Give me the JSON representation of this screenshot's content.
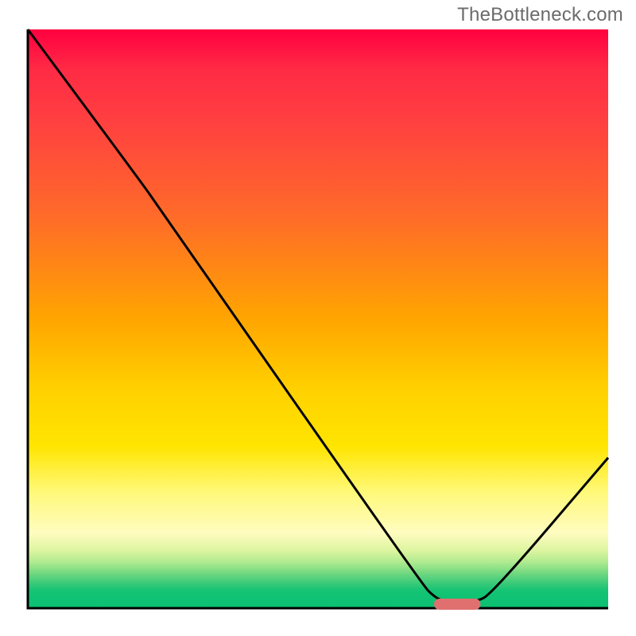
{
  "chart_data": {
    "type": "line",
    "watermark": "TheBottleneck.com",
    "xlabel": "",
    "ylabel": "",
    "xlim": [
      0,
      100
    ],
    "ylim": [
      0,
      100
    ],
    "curve_points": [
      {
        "x": 0,
        "y": 100
      },
      {
        "x": 20,
        "y": 73
      },
      {
        "x": 22,
        "y": 70
      },
      {
        "x": 68,
        "y": 4
      },
      {
        "x": 70,
        "y": 2
      },
      {
        "x": 72,
        "y": 1
      },
      {
        "x": 77,
        "y": 1
      },
      {
        "x": 80,
        "y": 2.5
      },
      {
        "x": 100,
        "y": 26
      }
    ],
    "optimal_region": {
      "start": 70,
      "end": 78
    },
    "marker_color": "#e07070"
  }
}
